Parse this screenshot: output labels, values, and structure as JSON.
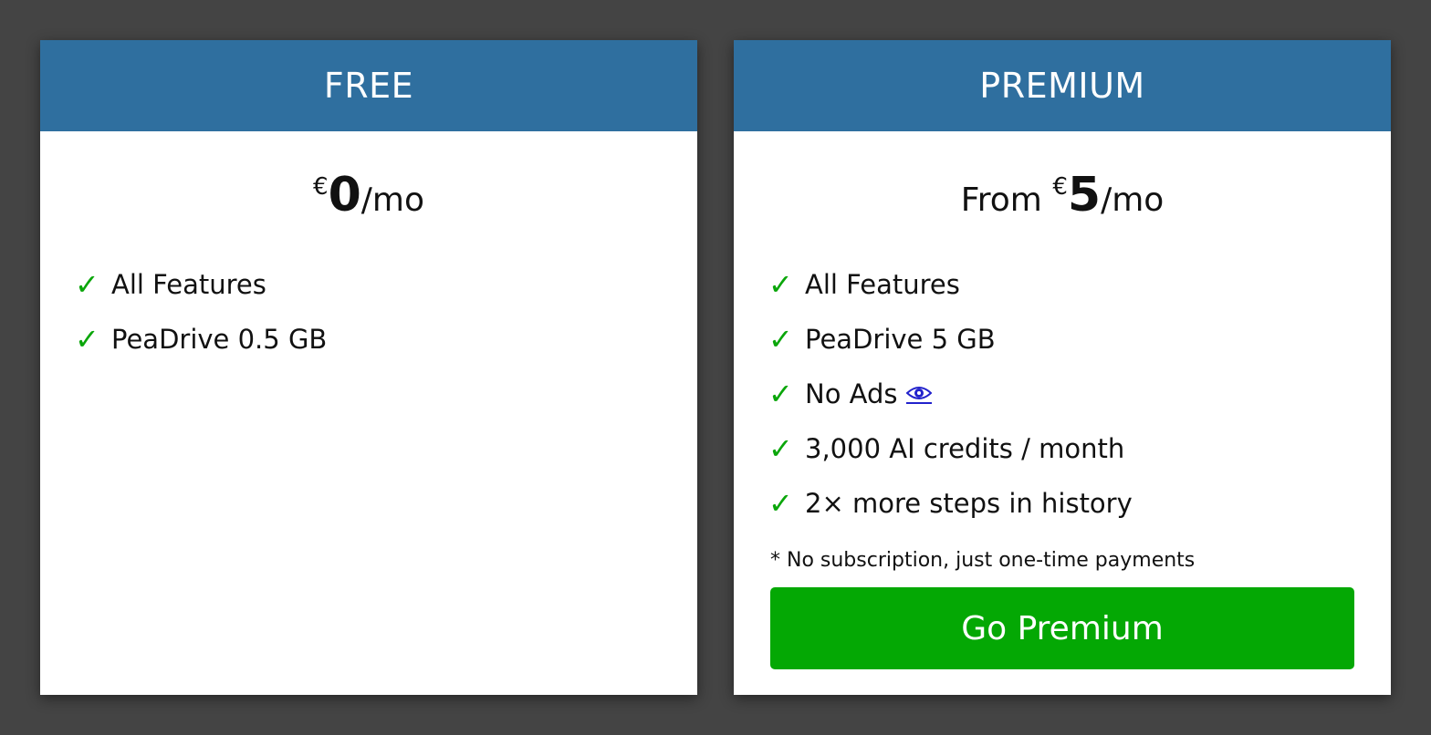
{
  "plans": {
    "free": {
      "title": "FREE",
      "currency": "€",
      "amount": "0",
      "period": "/mo",
      "features": [
        "All Features",
        "PeaDrive 0.5 GB"
      ]
    },
    "premium": {
      "title": "PREMIUM",
      "price_prefix": "From ",
      "currency": "€",
      "amount": "5",
      "period": "/mo",
      "features": [
        "All Features",
        "PeaDrive 5 GB",
        "No Ads",
        "3,000 AI credits / month",
        "2× more steps in history"
      ],
      "footnote": "* No subscription, just one-time payments",
      "cta_label": "Go Premium"
    }
  },
  "icons": {
    "check": "✓",
    "no_ads_info": "eye-icon"
  },
  "colors": {
    "background": "#444444",
    "header": "#2f6f9f",
    "check": "#0aa60a",
    "cta": "#04a804",
    "link": "#2222cc"
  }
}
